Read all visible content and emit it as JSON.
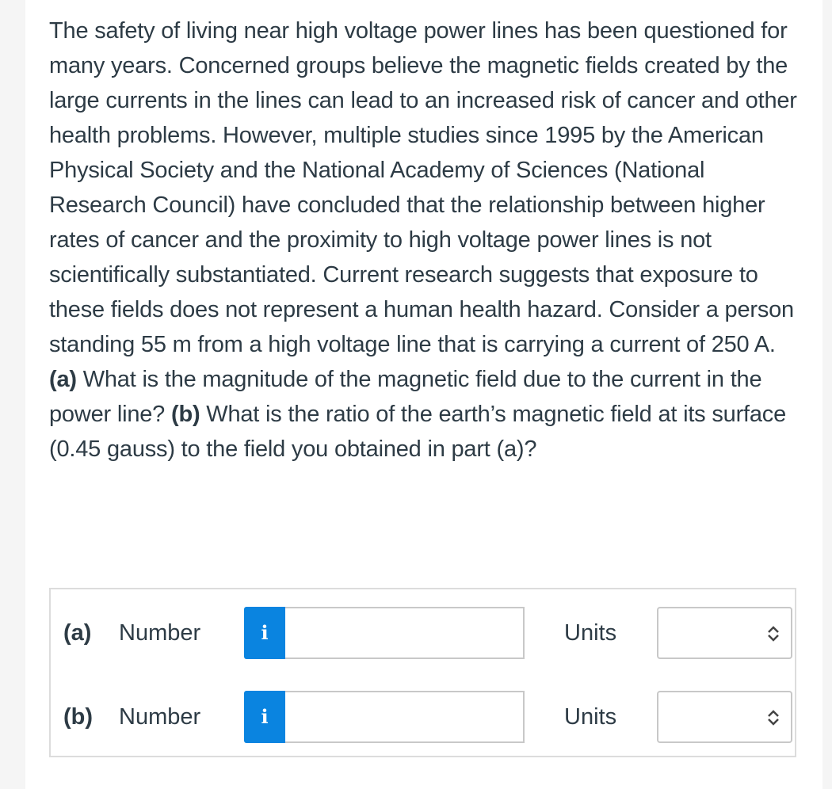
{
  "question": {
    "segments": [
      {
        "text": "The safety of living near high voltage power lines has been questioned for many years. Concerned groups believe the magnetic fields created by the large currents in the lines can lead to an increased risk of cancer and other health problems. However, multiple studies since 1995 by the American Physical Society and the National Academy of Sciences (National Research Council) have concluded that the relationship between higher rates of cancer and the proximity to high voltage power lines is not scientifically substantiated. Current research suggests that exposure to these fields does not represent a human health hazard. Consider a person standing 55 m from a high voltage line that is carrying a current of 250 A. ",
        "bold": false
      },
      {
        "text": "(a)",
        "bold": true
      },
      {
        "text": " What is the magnitude of the magnetic field due to the current in the power line? ",
        "bold": false
      },
      {
        "text": "(b)",
        "bold": true
      },
      {
        "text": " What is the ratio of the earth’s magnetic field at its surface (0.45 gauss) to the field you obtained in part (a)?",
        "bold": false
      }
    ]
  },
  "answers": [
    {
      "part": "(a)",
      "number_label": "Number",
      "info_icon": "i",
      "number_value": "",
      "units_label": "Units",
      "units_selected": ""
    },
    {
      "part": "(b)",
      "number_label": "Number",
      "info_icon": "i",
      "number_value": "",
      "units_label": "Units",
      "units_selected": ""
    }
  ],
  "colors": {
    "info_button": "#0a84e0",
    "text": "#2d3b45"
  }
}
